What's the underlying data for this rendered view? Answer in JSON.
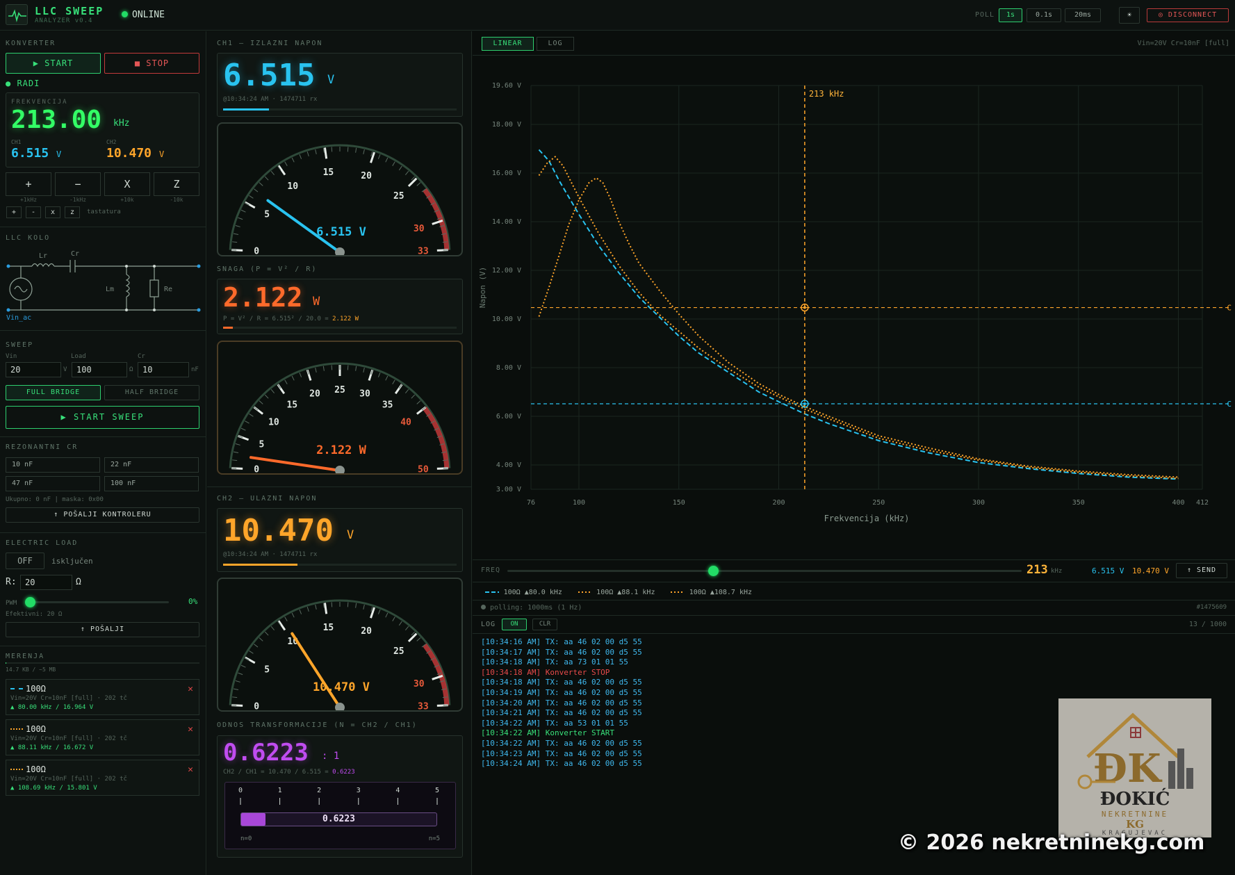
{
  "header": {
    "title": "LLC SWEEP",
    "subtitle": "ANALYZER v0.4",
    "status": "ONLINE",
    "poll_label": "POLL",
    "poll_options": [
      "1s",
      "0.1s",
      "20ms"
    ],
    "theme_glyph": "☀",
    "disconnect_label": "◎ DISCONNECT"
  },
  "converter": {
    "section": "KONVERTER",
    "start_label": "▶ START",
    "stop_label": "■ STOP",
    "state": "● RADI",
    "freq_label": "FREKVENCIJA",
    "freq_value": "213.00",
    "freq_unit": "kHz",
    "ch1_label": "CH1",
    "ch1_value": "6.515",
    "ch1_unit": "V",
    "ch2_label": "CH2",
    "ch2_value": "10.470",
    "ch2_unit": "V",
    "keys": [
      {
        "label": "+",
        "sub": "+1kHz"
      },
      {
        "label": "−",
        "sub": "-1kHz"
      },
      {
        "label": "X",
        "sub": "+10k"
      },
      {
        "label": "Z",
        "sub": "-10k"
      }
    ],
    "small_keys": [
      "+",
      "-",
      "x",
      "z"
    ],
    "keyboard_label": "tastatura"
  },
  "llc": {
    "section": "LLC KOLO",
    "lr": "Lr",
    "cr": "Cr",
    "lm": "Lm",
    "re": "Re",
    "source": "Vin_ac"
  },
  "sweep": {
    "section": "SWEEP",
    "vin_label": "Vin",
    "vin_value": "20",
    "vin_unit": "V",
    "load_label": "Load",
    "load_value": "100",
    "load_unit": "Ω",
    "cr_label": "Cr",
    "cr_value": "10",
    "cr_unit": "nF",
    "full_bridge": "FULL BRIDGE",
    "half_bridge": "HALF BRIDGE",
    "start_sweep": "▶ START SWEEP"
  },
  "resonant": {
    "section": "REZONANTNI CR",
    "caps": [
      "10 nF",
      "22 nF",
      "47 nF",
      "100 nF"
    ],
    "summary": "Ukupno: 0 nF | maska: 0x00",
    "send_label": "↑ POŠALJI KONTROLERU"
  },
  "eload": {
    "section": "ELECTRIC LOAD",
    "toggle": "OFF",
    "state": "isključen",
    "r_label": "R:",
    "r_value": "20",
    "r_unit": "Ω",
    "pwm_label": "PWM",
    "pwm_value": "0%",
    "pwm_fraction": 0,
    "effective": "Efektivni: 20 Ω",
    "send_label": "↑ POŠALJI"
  },
  "measurements": {
    "section": "MERENJA",
    "storage": "14.7 KB / ~5 MB",
    "storage_fraction": 0.003,
    "items": [
      {
        "name": "100Ω",
        "desc": "Vin=20V Cr=10nF [full] · 202 tč",
        "peak": "▲ 80.00 kHz / 16.964 V",
        "color": "#29c3f0"
      },
      {
        "name": "100Ω",
        "desc": "Vin=20V Cr=10nF [full] · 202 tč",
        "peak": "▲ 88.11 kHz / 16.672 V",
        "color": "#ffa52a"
      },
      {
        "name": "100Ω",
        "desc": "Vin=20V Cr=10nF [full] · 202 tč",
        "peak": "▲ 108.69 kHz / 15.801 V",
        "color": "#ffa52a"
      }
    ]
  },
  "ch1": {
    "section": "CH1 — IZLAZNI NAPON",
    "value": "6.515",
    "unit": "V",
    "meta": "@10:34:24 AM · 1474711 rx",
    "bar_fraction": 0.197,
    "gauge_min": 0,
    "gauge_max": 33,
    "gauge_ticks": [
      "0",
      "5",
      "10",
      "15",
      "20",
      "25",
      "30",
      "33"
    ],
    "gauge_value": 6.515,
    "gauge_readout": "6.515 V"
  },
  "power": {
    "section": "SNAGA (P = V² / R)",
    "value": "2.122",
    "unit": "W",
    "formula": "P = V² / R = 6.515² / 20.0 = ",
    "formula_result": "2.122 W",
    "bar_fraction": 0.042,
    "gauge_min": 0,
    "gauge_max": 50,
    "gauge_ticks": [
      "0",
      "5",
      "10",
      "15",
      "20",
      "25",
      "30",
      "35",
      "40",
      "50"
    ],
    "gauge_value": 2.122,
    "gauge_readout": "2.122 W"
  },
  "ch2": {
    "section": "CH2 — ULAZNI NAPON",
    "value": "10.470",
    "unit": "V",
    "meta": "@10:34:24 AM · 1474711 rx",
    "bar_fraction": 0.317,
    "gauge_min": 0,
    "gauge_max": 33,
    "gauge_ticks": [
      "0",
      "5",
      "10",
      "15",
      "20",
      "25",
      "30",
      "33"
    ],
    "gauge_value": 10.47,
    "gauge_readout": "10.470 V"
  },
  "ratio": {
    "section": "ODNOS TRANSFORMACIJE (N = CH2 / CH1)",
    "value": "0.6223",
    "unit": ": 1",
    "formula": "CH2 / CH1 = 10.470 / 6.515 = ",
    "formula_result": "0.6223",
    "scale_ticks": [
      "0",
      "1",
      "2",
      "3",
      "4",
      "5"
    ],
    "fraction": 0.1245,
    "bar_label": "0.6223",
    "min_label": "n=0",
    "max_label": "n=5"
  },
  "chart": {
    "tabs": [
      "LINEAR",
      "LOG"
    ],
    "info": "Vin=20V Cr=10nF [full]",
    "cursor_label": "213 kHz",
    "ch2_tag": "C",
    "ch1_tag": "C",
    "freq_label": "FREQ",
    "freq_value": "213",
    "freq_unit": "kHz",
    "freq_fraction": 0.4001,
    "readout_ch1": "6.515 V",
    "readout_ch2": "10.470 V",
    "send_label": "↑ SEND",
    "polling": "polling: 1000ms (1 Hz)",
    "packet": "#1475609",
    "legend": [
      {
        "label": "100Ω ▲80.0 kHz",
        "color": "#29c3f0",
        "dash": "6,3"
      },
      {
        "label": "100Ω ▲88.1 kHz",
        "color": "#ffa52a",
        "dash": "2,3"
      },
      {
        "label": "100Ω ▲108.7 kHz",
        "color": "#ffa52a",
        "dash": "2,3"
      }
    ]
  },
  "chart_data": {
    "type": "line",
    "xlabel": "Frekvencija (kHz)",
    "ylabel": "Napon (V)",
    "xlim": [
      76,
      412
    ],
    "ylim": [
      3.0,
      19.6
    ],
    "x_ticks": [
      76,
      100,
      150,
      200,
      250,
      300,
      350,
      400,
      412
    ],
    "y_ticks": [
      {
        "v": 3.0,
        "label": "3.00 V"
      },
      {
        "v": 4.0,
        "label": "4.00 V"
      },
      {
        "v": 6.0,
        "label": "6.00 V"
      },
      {
        "v": 8.0,
        "label": "8.00 V"
      },
      {
        "v": 10.0,
        "label": "10.00 V"
      },
      {
        "v": 12.0,
        "label": "12.00 V"
      },
      {
        "v": 14.0,
        "label": "14.00 V"
      },
      {
        "v": 16.0,
        "label": "16.00 V"
      },
      {
        "v": 18.0,
        "label": "18.00 V"
      },
      {
        "v": 19.6,
        "label": "19.60 V"
      }
    ],
    "cursor_x": 213,
    "cursor_ch1": 6.515,
    "cursor_ch2": 10.47,
    "series": [
      {
        "name": "100Ω ▲80.0 kHz",
        "color": "#29c3f0",
        "dash": "7,4",
        "x": [
          80,
          85,
          90,
          100,
          110,
          120,
          130,
          140,
          150,
          160,
          175,
          190,
          200,
          213,
          225,
          250,
          275,
          300,
          325,
          350,
          375,
          400
        ],
        "y": [
          16.96,
          16.5,
          15.7,
          14.3,
          13.0,
          11.9,
          10.9,
          10.1,
          9.3,
          8.6,
          7.8,
          7.0,
          6.6,
          6.1,
          5.7,
          5.0,
          4.5,
          4.1,
          3.85,
          3.65,
          3.5,
          3.42
        ]
      },
      {
        "name": "100Ω ▲88.1 kHz",
        "color": "#ffa52a",
        "dash": "2,3",
        "x": [
          80,
          84,
          88.1,
          92,
          100,
          110,
          120,
          130,
          140,
          150,
          160,
          175,
          190,
          200,
          213,
          225,
          250,
          275,
          300,
          325,
          350,
          375,
          400
        ],
        "y": [
          15.9,
          16.4,
          16.67,
          16.3,
          15.0,
          13.5,
          12.2,
          11.1,
          10.2,
          9.5,
          8.8,
          7.95,
          7.2,
          6.8,
          6.3,
          5.9,
          5.1,
          4.6,
          4.2,
          3.9,
          3.7,
          3.55,
          3.45
        ]
      },
      {
        "name": "100Ω ▲108.7 kHz",
        "color": "#ffa52a",
        "dash": "2,3",
        "x": [
          80,
          85,
          90,
          95,
          100,
          105,
          108.69,
          112,
          116,
          120,
          125,
          130,
          140,
          150,
          160,
          175,
          190,
          200,
          213,
          225,
          250,
          275,
          300,
          325,
          350,
          375,
          400
        ],
        "y": [
          10.1,
          11.3,
          12.6,
          13.9,
          14.9,
          15.6,
          15.8,
          15.6,
          14.9,
          14.0,
          13.1,
          12.3,
          11.2,
          10.2,
          9.3,
          8.2,
          7.35,
          6.9,
          6.4,
          6.0,
          5.2,
          4.7,
          4.25,
          3.95,
          3.75,
          3.6,
          3.5
        ]
      }
    ]
  },
  "log": {
    "label": "LOG",
    "on_label": "ON",
    "clr_label": "CLR",
    "count": "13 / 1000",
    "lines": [
      {
        "text": "[10:34:16 AM] TX: aa 46 02 00 d5 55",
        "color": "#3fb8ee"
      },
      {
        "text": "[10:34:17 AM] TX: aa 46 02 00 d5 55",
        "color": "#3fb8ee"
      },
      {
        "text": "[10:34:18 AM] TX: aa 73 01 01 55",
        "color": "#3fb8ee"
      },
      {
        "text": "[10:34:18 AM] Konverter STOP",
        "color": "#e84a4a"
      },
      {
        "text": "[10:34:18 AM] TX: aa 46 02 00 d5 55",
        "color": "#3fb8ee"
      },
      {
        "text": "[10:34:19 AM] TX: aa 46 02 00 d5 55",
        "color": "#3fb8ee"
      },
      {
        "text": "[10:34:20 AM] TX: aa 46 02 00 d5 55",
        "color": "#3fb8ee"
      },
      {
        "text": "[10:34:21 AM] TX: aa 46 02 00 d5 55",
        "color": "#3fb8ee"
      },
      {
        "text": "[10:34:22 AM] TX: aa 53 01 01 55",
        "color": "#3fb8ee"
      },
      {
        "text": "[10:34:22 AM] Konverter START",
        "color": "#38e07a"
      },
      {
        "text": "[10:34:22 AM] TX: aa 46 02 00 d5 55",
        "color": "#3fb8ee"
      },
      {
        "text": "[10:34:23 AM] TX: aa 46 02 00 d5 55",
        "color": "#3fb8ee"
      },
      {
        "text": "[10:34:24 AM] TX: aa 46 02 00 d5 55",
        "color": "#3fb8ee"
      }
    ]
  },
  "watermark": {
    "brand": "ĐOKIĆ",
    "line1": "NEKRETNINE",
    "line2": "KG",
    "line3": "KRAGUJEVAC",
    "copyright": "© 2026 nekretninekg.com"
  }
}
